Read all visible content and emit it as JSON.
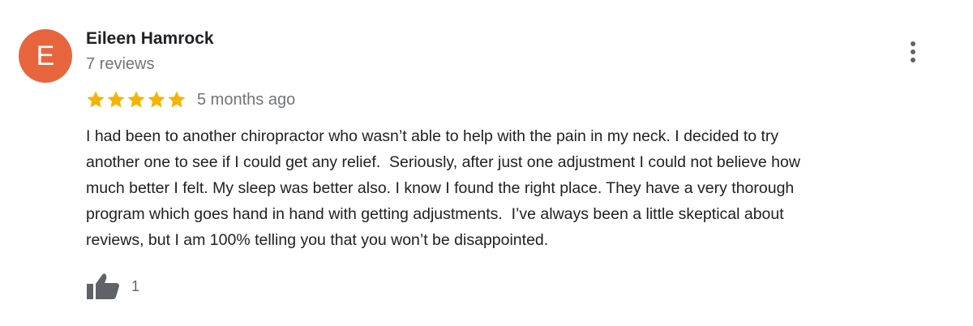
{
  "review": {
    "avatar_initial": "E",
    "author_name": "Eileen Hamrock",
    "review_count": "7 reviews",
    "rating": 5,
    "max_rating": 5,
    "date": "5 months ago",
    "text": "I had been to another chiropractor who wasn’t able to help with the pain in my neck. I decided to try\nanother one to see if I could get any relief.  Seriously, after just one adjustment I could not believe how\nmuch better I felt. My sleep was better also. I know I found the right place. They have a very thorough\nprogram which goes hand in hand with getting adjustments.  I’ve always been a little skeptical about\nreviews, but I am 100% telling you that you won’t be disappointed.",
    "like_count": "1"
  },
  "icons": {
    "more": "more-vertical-icon",
    "star": "star-icon",
    "like": "thumbs-up-icon"
  },
  "colors": {
    "avatar_bg": "#e8643c",
    "star": "#f4b400",
    "secondary_text": "#70757a",
    "primary_text": "#202124",
    "icon_gray": "#5f6368"
  }
}
